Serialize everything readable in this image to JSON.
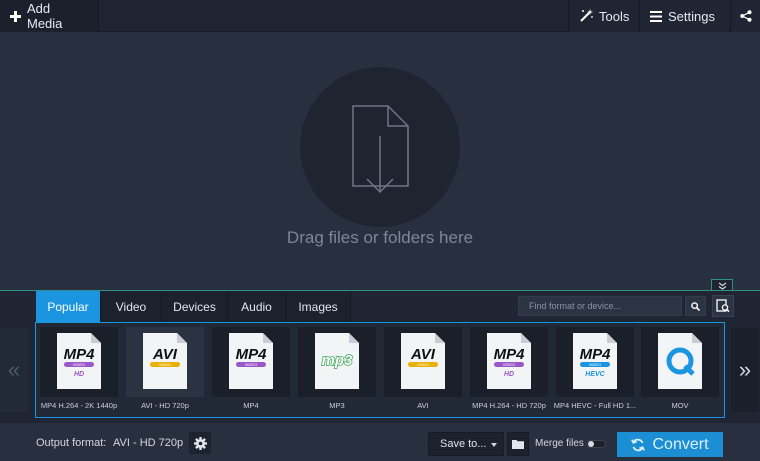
{
  "topbar": {
    "add_media": "Add Media",
    "tools": "Tools",
    "settings": "Settings",
    "icons": [
      "plus-icon",
      "magic-wand-icon",
      "hamburger-icon",
      "share-icon"
    ]
  },
  "dropzone": {
    "text": "Drag files or folders here",
    "icon": "file-download-icon"
  },
  "tabs": [
    {
      "label": "Popular",
      "active": true
    },
    {
      "label": "Video",
      "active": false
    },
    {
      "label": "Devices",
      "active": false
    },
    {
      "label": "Audio",
      "active": false
    },
    {
      "label": "Images",
      "active": false
    }
  ],
  "search": {
    "placeholder": "Find format or device..."
  },
  "presets": [
    {
      "badge": "MP4",
      "band": "VIDEO",
      "sub": "HD",
      "label": "MP4 H.264 - 2K 1440p",
      "band_color": "#9b57c9",
      "sub_color": "#9b57c9"
    },
    {
      "badge": "AVI",
      "band": "VIDEO",
      "sub": "",
      "label": "AVI - HD 720p",
      "band_color": "#e8b000",
      "sub_color": ""
    },
    {
      "badge": "MP4",
      "band": "VIDEO",
      "sub": "",
      "label": "MP4",
      "band_color": "#9b57c9",
      "sub_color": ""
    },
    {
      "badge": "mp3",
      "band": "",
      "sub": "",
      "label": "MP3",
      "band_color": "#2ea44f",
      "sub_color": ""
    },
    {
      "badge": "AVI",
      "band": "VIDEO",
      "sub": "",
      "label": "AVI",
      "band_color": "#e8b000",
      "sub_color": ""
    },
    {
      "badge": "MP4",
      "band": "VIDEO",
      "sub": "HD",
      "label": "MP4 H.264 - HD 720p",
      "band_color": "#9b57c9",
      "sub_color": "#9b57c9"
    },
    {
      "badge": "MP4",
      "band": "VIDEO",
      "sub": "HEVC",
      "label": "MP4 HEVC - Full HD 1...",
      "band_color": "#1b95e0",
      "sub_color": "#1b95e0"
    },
    {
      "badge": "Q",
      "band": "",
      "sub": "",
      "label": "MOV",
      "band_color": "#1b95e0",
      "sub_color": ""
    }
  ],
  "bottombar": {
    "output_label": "Output format:",
    "output_value": "AVI - HD 720p",
    "save_to": "Save to...",
    "merge_files": "Merge files",
    "merge_enabled": false,
    "convert": "Convert"
  },
  "colors": {
    "accent": "#1b95e0",
    "teal_line": "#2f8f86",
    "background": "#28303f",
    "panel": "#1f2532"
  }
}
